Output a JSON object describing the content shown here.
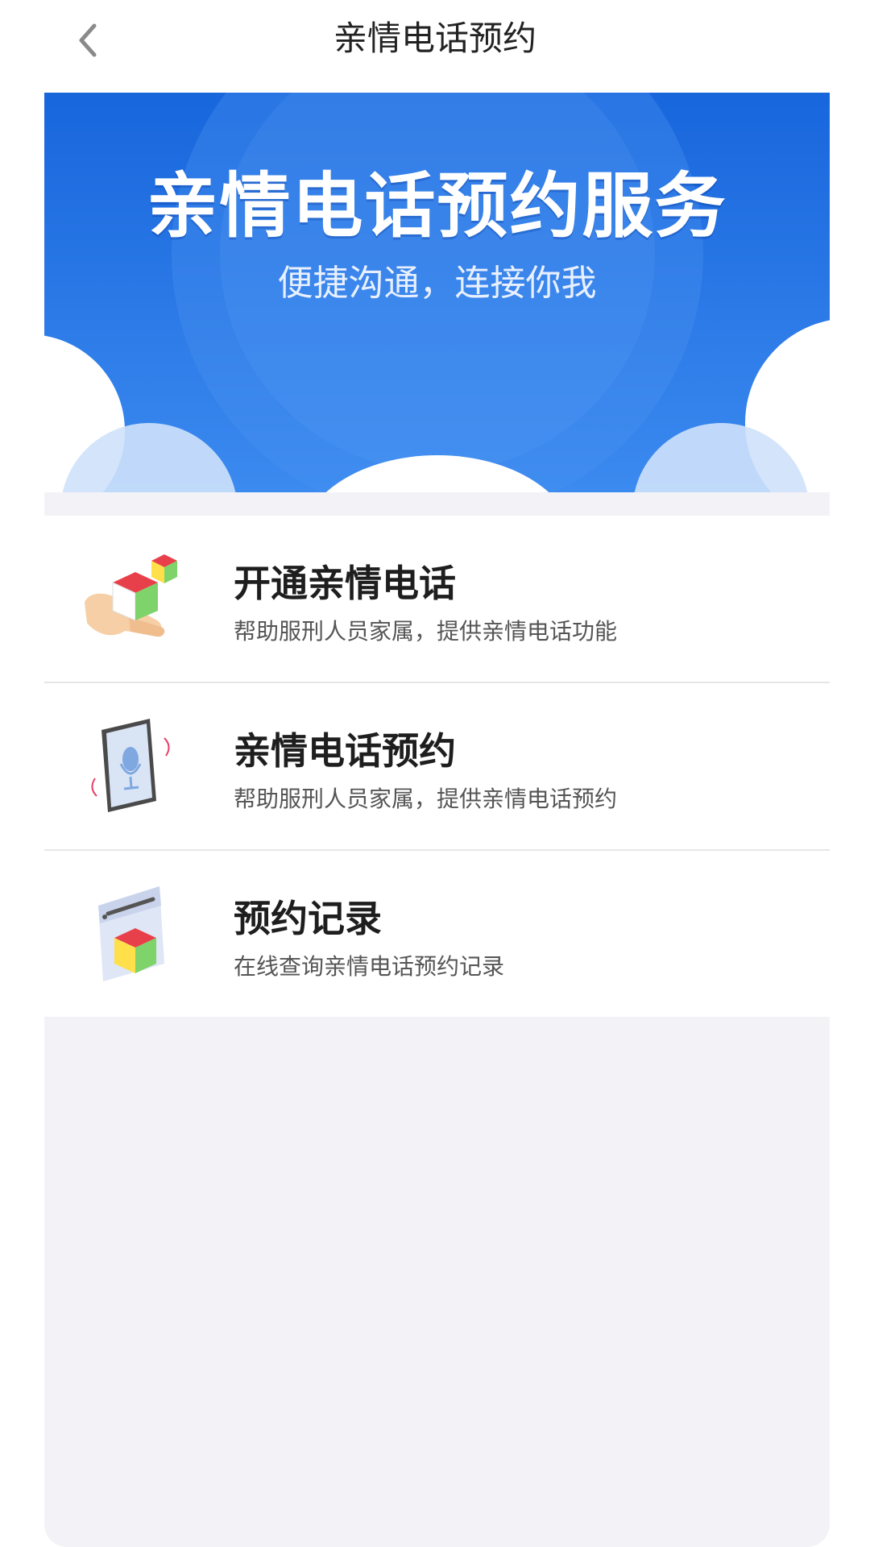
{
  "header": {
    "title": "亲情电话预约",
    "back_icon": "chevron-left-icon"
  },
  "banner": {
    "title": "亲情电话预约服务",
    "subtitle": "便捷沟通，连接你我",
    "colors": {
      "top": "#1a6ee0",
      "bottom": "#3c8cf0",
      "cloud": "#ffffff"
    }
  },
  "menu": {
    "items": [
      {
        "title": "开通亲情电话",
        "desc": "帮助服刑人员家属，提供亲情电话功能",
        "icon": "hand-cube-icon"
      },
      {
        "title": "亲情电话预约",
        "desc": "帮助服刑人员家属，提供亲情电话预约",
        "icon": "tablet-microphone-icon"
      },
      {
        "title": "预约记录",
        "desc": "在线查询亲情电话预约记录",
        "icon": "record-cube-icon"
      }
    ]
  },
  "colors": {
    "page_bg": "#ffffff",
    "panel_bg": "#f3f2f7",
    "text_primary": "#1e1e1e",
    "text_secondary": "#555555"
  }
}
